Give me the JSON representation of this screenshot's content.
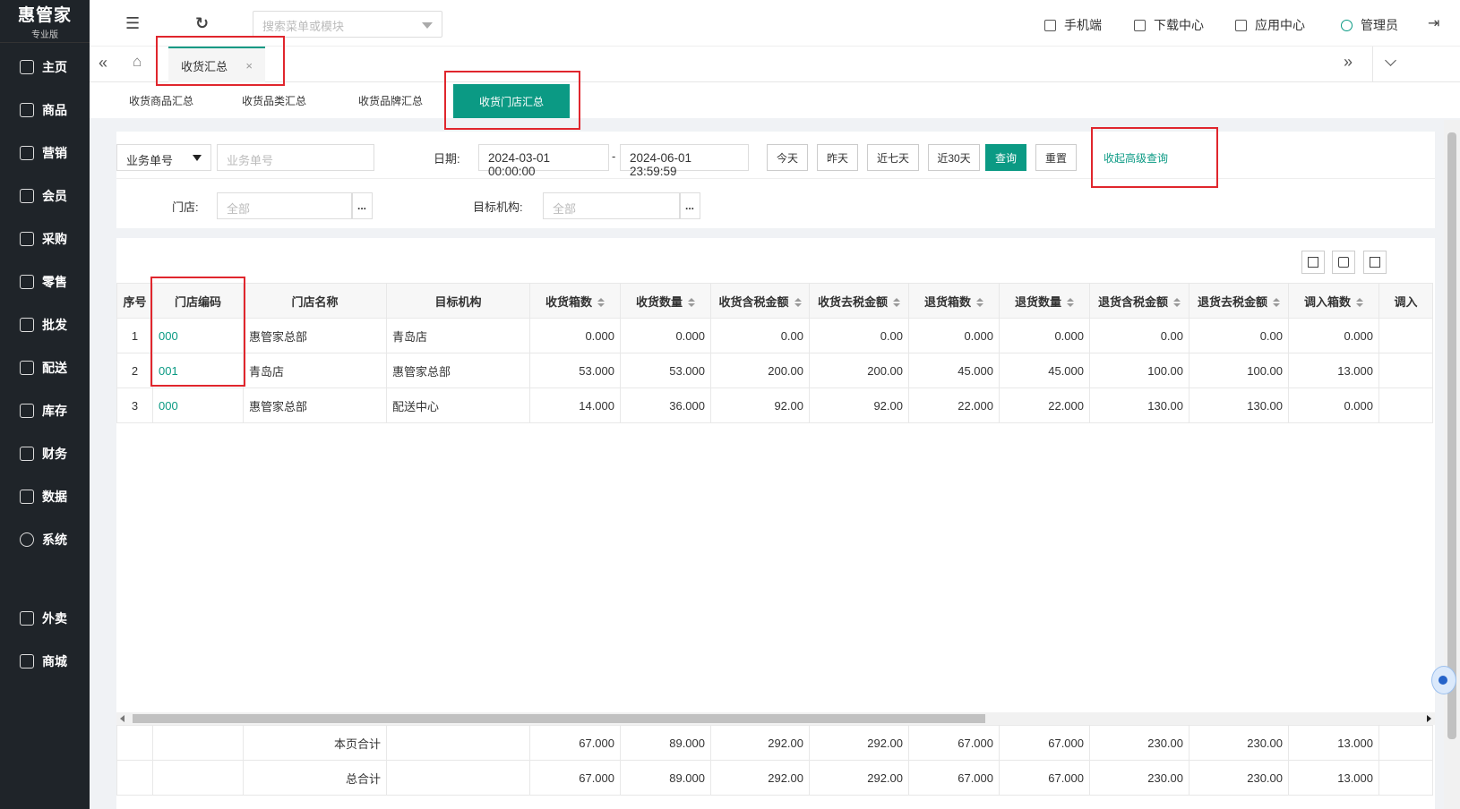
{
  "brand": {
    "name": "惠管家",
    "edition": "专业版"
  },
  "sidebar": {
    "items": [
      {
        "label": "主页",
        "icon": "home-icon"
      },
      {
        "label": "商品",
        "icon": "box-icon"
      },
      {
        "label": "营销",
        "icon": "chart-icon"
      },
      {
        "label": "会员",
        "icon": "heart-icon"
      },
      {
        "label": "采购",
        "icon": "clipboard-icon"
      },
      {
        "label": "零售",
        "icon": "bag-icon"
      },
      {
        "label": "批发",
        "icon": "building-icon"
      },
      {
        "label": "配送",
        "icon": "truck-icon"
      },
      {
        "label": "库存",
        "icon": "inbox-icon"
      },
      {
        "label": "财务",
        "icon": "yen-icon"
      },
      {
        "label": "数据",
        "icon": "bar-chart-icon"
      },
      {
        "label": "系统",
        "icon": "settings-icon"
      },
      {
        "label": "外卖",
        "icon": "scooter-icon"
      },
      {
        "label": "商城",
        "icon": "shop-icon"
      }
    ]
  },
  "topbar": {
    "search_placeholder": "搜索菜单或模块",
    "mobile": "手机端",
    "downloads": "下载中心",
    "apps": "应用中心",
    "user": "管理员"
  },
  "tabs": {
    "active": "收货汇总",
    "close": "×"
  },
  "subtabs": [
    "收货商品汇总",
    "收货品类汇总",
    "收货品牌汇总",
    "收货门店汇总"
  ],
  "filter": {
    "type_select": "业务单号",
    "number_placeholder": "业务单号",
    "date_label": "日期:",
    "date_from": "2024-03-01 00:00:00",
    "date_sep": "-",
    "date_to": "2024-06-01 23:59:59",
    "quick": [
      "今天",
      "昨天",
      "近七天",
      "近30天"
    ],
    "query": "查询",
    "reset": "重置",
    "advanced": "收起高级查询",
    "store_label": "门店:",
    "store_placeholder": "全部",
    "target_label": "目标机构:",
    "target_placeholder": "全部",
    "dots": "..."
  },
  "table": {
    "headers": [
      "序号",
      "门店编码",
      "门店名称",
      "目标机构",
      "收货箱数",
      "收货数量",
      "收货含税金额",
      "收货去税金额",
      "退货箱数",
      "退货数量",
      "退货含税金额",
      "退货去税金额",
      "调入箱数",
      "调入"
    ],
    "rows": [
      [
        "1",
        "000",
        "惠管家总部",
        "青岛店",
        "0.000",
        "0.000",
        "0.00",
        "0.00",
        "0.000",
        "0.000",
        "0.00",
        "0.00",
        "0.000"
      ],
      [
        "2",
        "001",
        "青岛店",
        "惠管家总部",
        "53.000",
        "53.000",
        "200.00",
        "200.00",
        "45.000",
        "45.000",
        "100.00",
        "100.00",
        "13.000"
      ],
      [
        "3",
        "000",
        "惠管家总部",
        "配送中心",
        "14.000",
        "36.000",
        "92.00",
        "92.00",
        "22.000",
        "22.000",
        "130.00",
        "130.00",
        "0.000"
      ]
    ],
    "footer": [
      [
        "本页合计",
        "67.000",
        "89.000",
        "292.00",
        "292.00",
        "67.000",
        "67.000",
        "230.00",
        "230.00",
        "13.000"
      ],
      [
        "总合计",
        "67.000",
        "89.000",
        "292.00",
        "292.00",
        "67.000",
        "67.000",
        "230.00",
        "230.00",
        "13.000"
      ]
    ]
  },
  "colors": {
    "accent": "#0b9a84",
    "sidebar": "#1f2429",
    "highlight": "#e0262d"
  }
}
